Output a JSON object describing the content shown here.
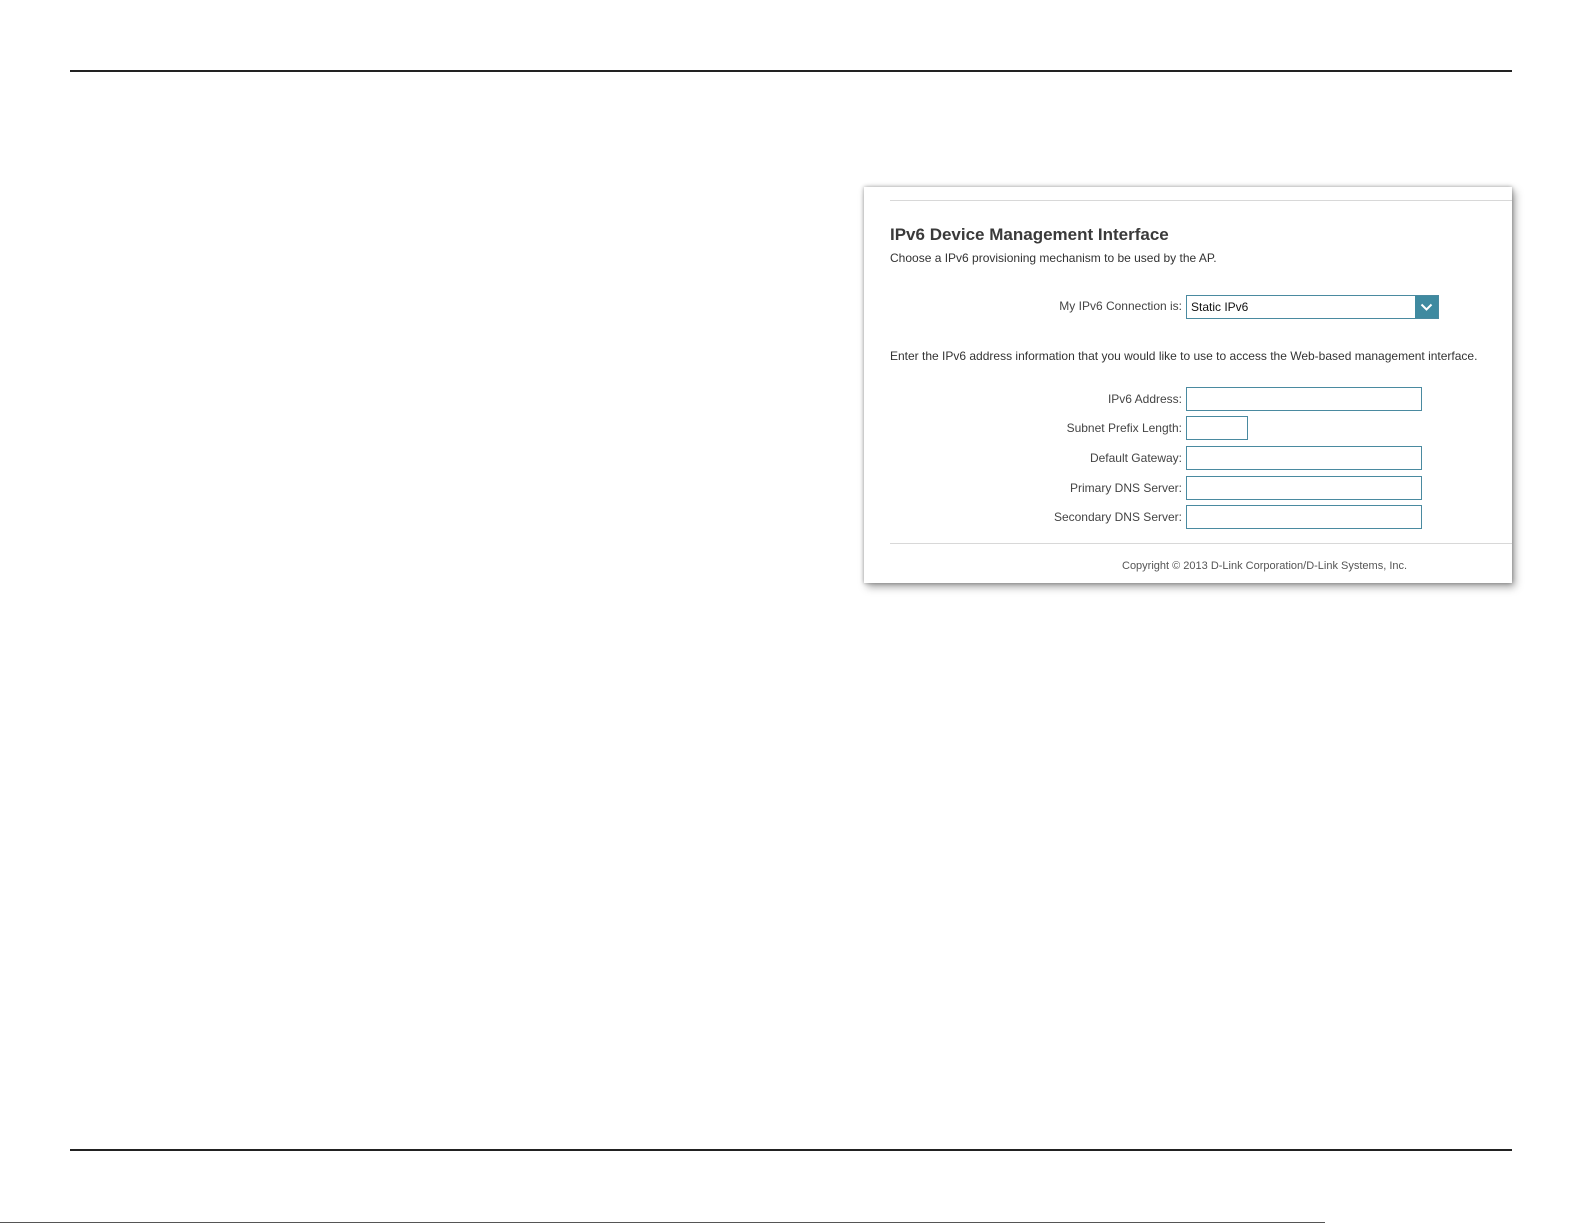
{
  "panel": {
    "title": "IPv6 Device Management Interface",
    "subtitle": "Choose a IPv6 provisioning mechanism to be used by the AP.",
    "connection": {
      "label": "My IPv6 Connection is:",
      "selected": "Static IPv6"
    },
    "info_text": "Enter the IPv6 address information that you would like to use to access the Web-based management interface.",
    "fields": {
      "ipv6_address": {
        "label": "IPv6 Address:",
        "value": ""
      },
      "subnet_prefix_length": {
        "label": "Subnet Prefix Length:",
        "value": ""
      },
      "default_gateway": {
        "label": "Default Gateway:",
        "value": ""
      },
      "primary_dns": {
        "label": "Primary DNS Server:",
        "value": ""
      },
      "secondary_dns": {
        "label": "Secondary DNS Server:",
        "value": ""
      }
    },
    "copyright": "Copyright © 2013 D-Link Corporation/D-Link Systems, Inc."
  },
  "colors": {
    "accent": "#3f8aa0",
    "rule": "#222222"
  },
  "icons": {
    "dropdown": "chevron-down-icon"
  }
}
